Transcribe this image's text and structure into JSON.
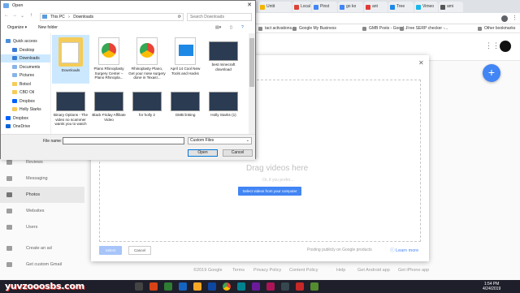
{
  "browser": {
    "tabs": [
      {
        "label": "Untit",
        "color": "#f4b400"
      },
      {
        "label": "Local",
        "color": "#db4437"
      },
      {
        "label": "Pinst",
        "color": "#4285f4"
      },
      {
        "label": "go ko",
        "color": "#4285f4"
      },
      {
        "label": "ant",
        "color": "#e53935"
      },
      {
        "label": "Tree",
        "color": "#1e88e5"
      },
      {
        "label": "Vimeo",
        "color": "#1ab7ea"
      },
      {
        "label": "ami",
        "color": "#555555"
      }
    ],
    "tab_close": "×",
    "bookmarks": [
      {
        "label": "tact activations..."
      },
      {
        "label": "Google My Business"
      },
      {
        "label": "GMB Posts - Googl..."
      },
      {
        "label": "Free SERP checker -..."
      },
      {
        "label": "Other bookmarks"
      }
    ]
  },
  "open_dialog": {
    "title": "Open",
    "close": "✕",
    "path": [
      "This PC",
      "Downloads"
    ],
    "path_sep": "›",
    "search_placeholder": "Search Downloads",
    "organize": "Organize ▾",
    "new_folder": "New folder",
    "tree": [
      {
        "label": "Quick access",
        "color": "#4b8fd9"
      },
      {
        "label": "Desktop",
        "color": "#3a7bd5"
      },
      {
        "label": "Downloads",
        "color": "#3a7bd5",
        "selected": true
      },
      {
        "label": "Documents",
        "color": "#8ab4e8"
      },
      {
        "label": "Pictures",
        "color": "#8ab4e8"
      },
      {
        "label": "Botsol",
        "color": "#f5cc58"
      },
      {
        "label": "CBD Oil",
        "color": "#f5cc58"
      },
      {
        "label": "Dropbox",
        "color": "#0061fe"
      },
      {
        "label": "Holly Starks",
        "color": "#f5cc58"
      },
      {
        "label": "Dropbox",
        "color": "#0061fe"
      },
      {
        "label": "OneDrive",
        "color": "#0a64d8"
      }
    ],
    "files": [
      {
        "label": "Downloads",
        "kind": "folder",
        "selected": true
      },
      {
        "label": "Plano Rhinoplasty Surgery Center – Plano Rhinopla...",
        "kind": "chrome"
      },
      {
        "label": "Rhinoplasty Plano, Get your nose surgery done in Texas!...",
        "kind": "chrome"
      },
      {
        "label": "April 14 Cool New Tools and Hacks",
        "kind": "mp4"
      },
      {
        "label": "best minecraft download",
        "kind": "video"
      },
      {
        "label": "Binary Options - The video no scammer wants you to watch",
        "kind": "video"
      },
      {
        "label": "Black Friday Affiliate Video",
        "kind": "video"
      },
      {
        "label": "for holly 2",
        "kind": "video"
      },
      {
        "label": "GMB linking",
        "kind": "video"
      },
      {
        "label": "Holly Starks (1)",
        "kind": "video"
      }
    ],
    "filename_label": "File name:",
    "filename_value": "",
    "filetype": "Custom Files",
    "open_button": "Open",
    "cancel_button": "Cancel"
  },
  "upload_dialog": {
    "drop_title": "Drag videos here",
    "drop_sub": "Or, if you prefer...",
    "select_button": "Select videos from your computer",
    "select": "Select",
    "cancel": "Cancel",
    "posting_note": "Posting publicly on Google products",
    "learn_more": "Learn more",
    "close": "✕"
  },
  "sidebar": {
    "items": [
      {
        "label": "Reviews"
      },
      {
        "label": "Messaging"
      },
      {
        "label": "Photos",
        "active": true
      },
      {
        "label": "Websites"
      },
      {
        "label": "Users"
      },
      {
        "label": "Create an ad"
      },
      {
        "label": "Get custom Gmail"
      }
    ]
  },
  "footer": {
    "links": [
      "©2019 Google",
      "Terms",
      "Privacy Policy",
      "Content Policy",
      "Help",
      "Get Android app",
      "Get iPhone app"
    ]
  },
  "fab": "+",
  "taskbar": {
    "watermark": "yuvzooosbs.com",
    "time": "1:54 PM",
    "date": "4/24/2019"
  }
}
